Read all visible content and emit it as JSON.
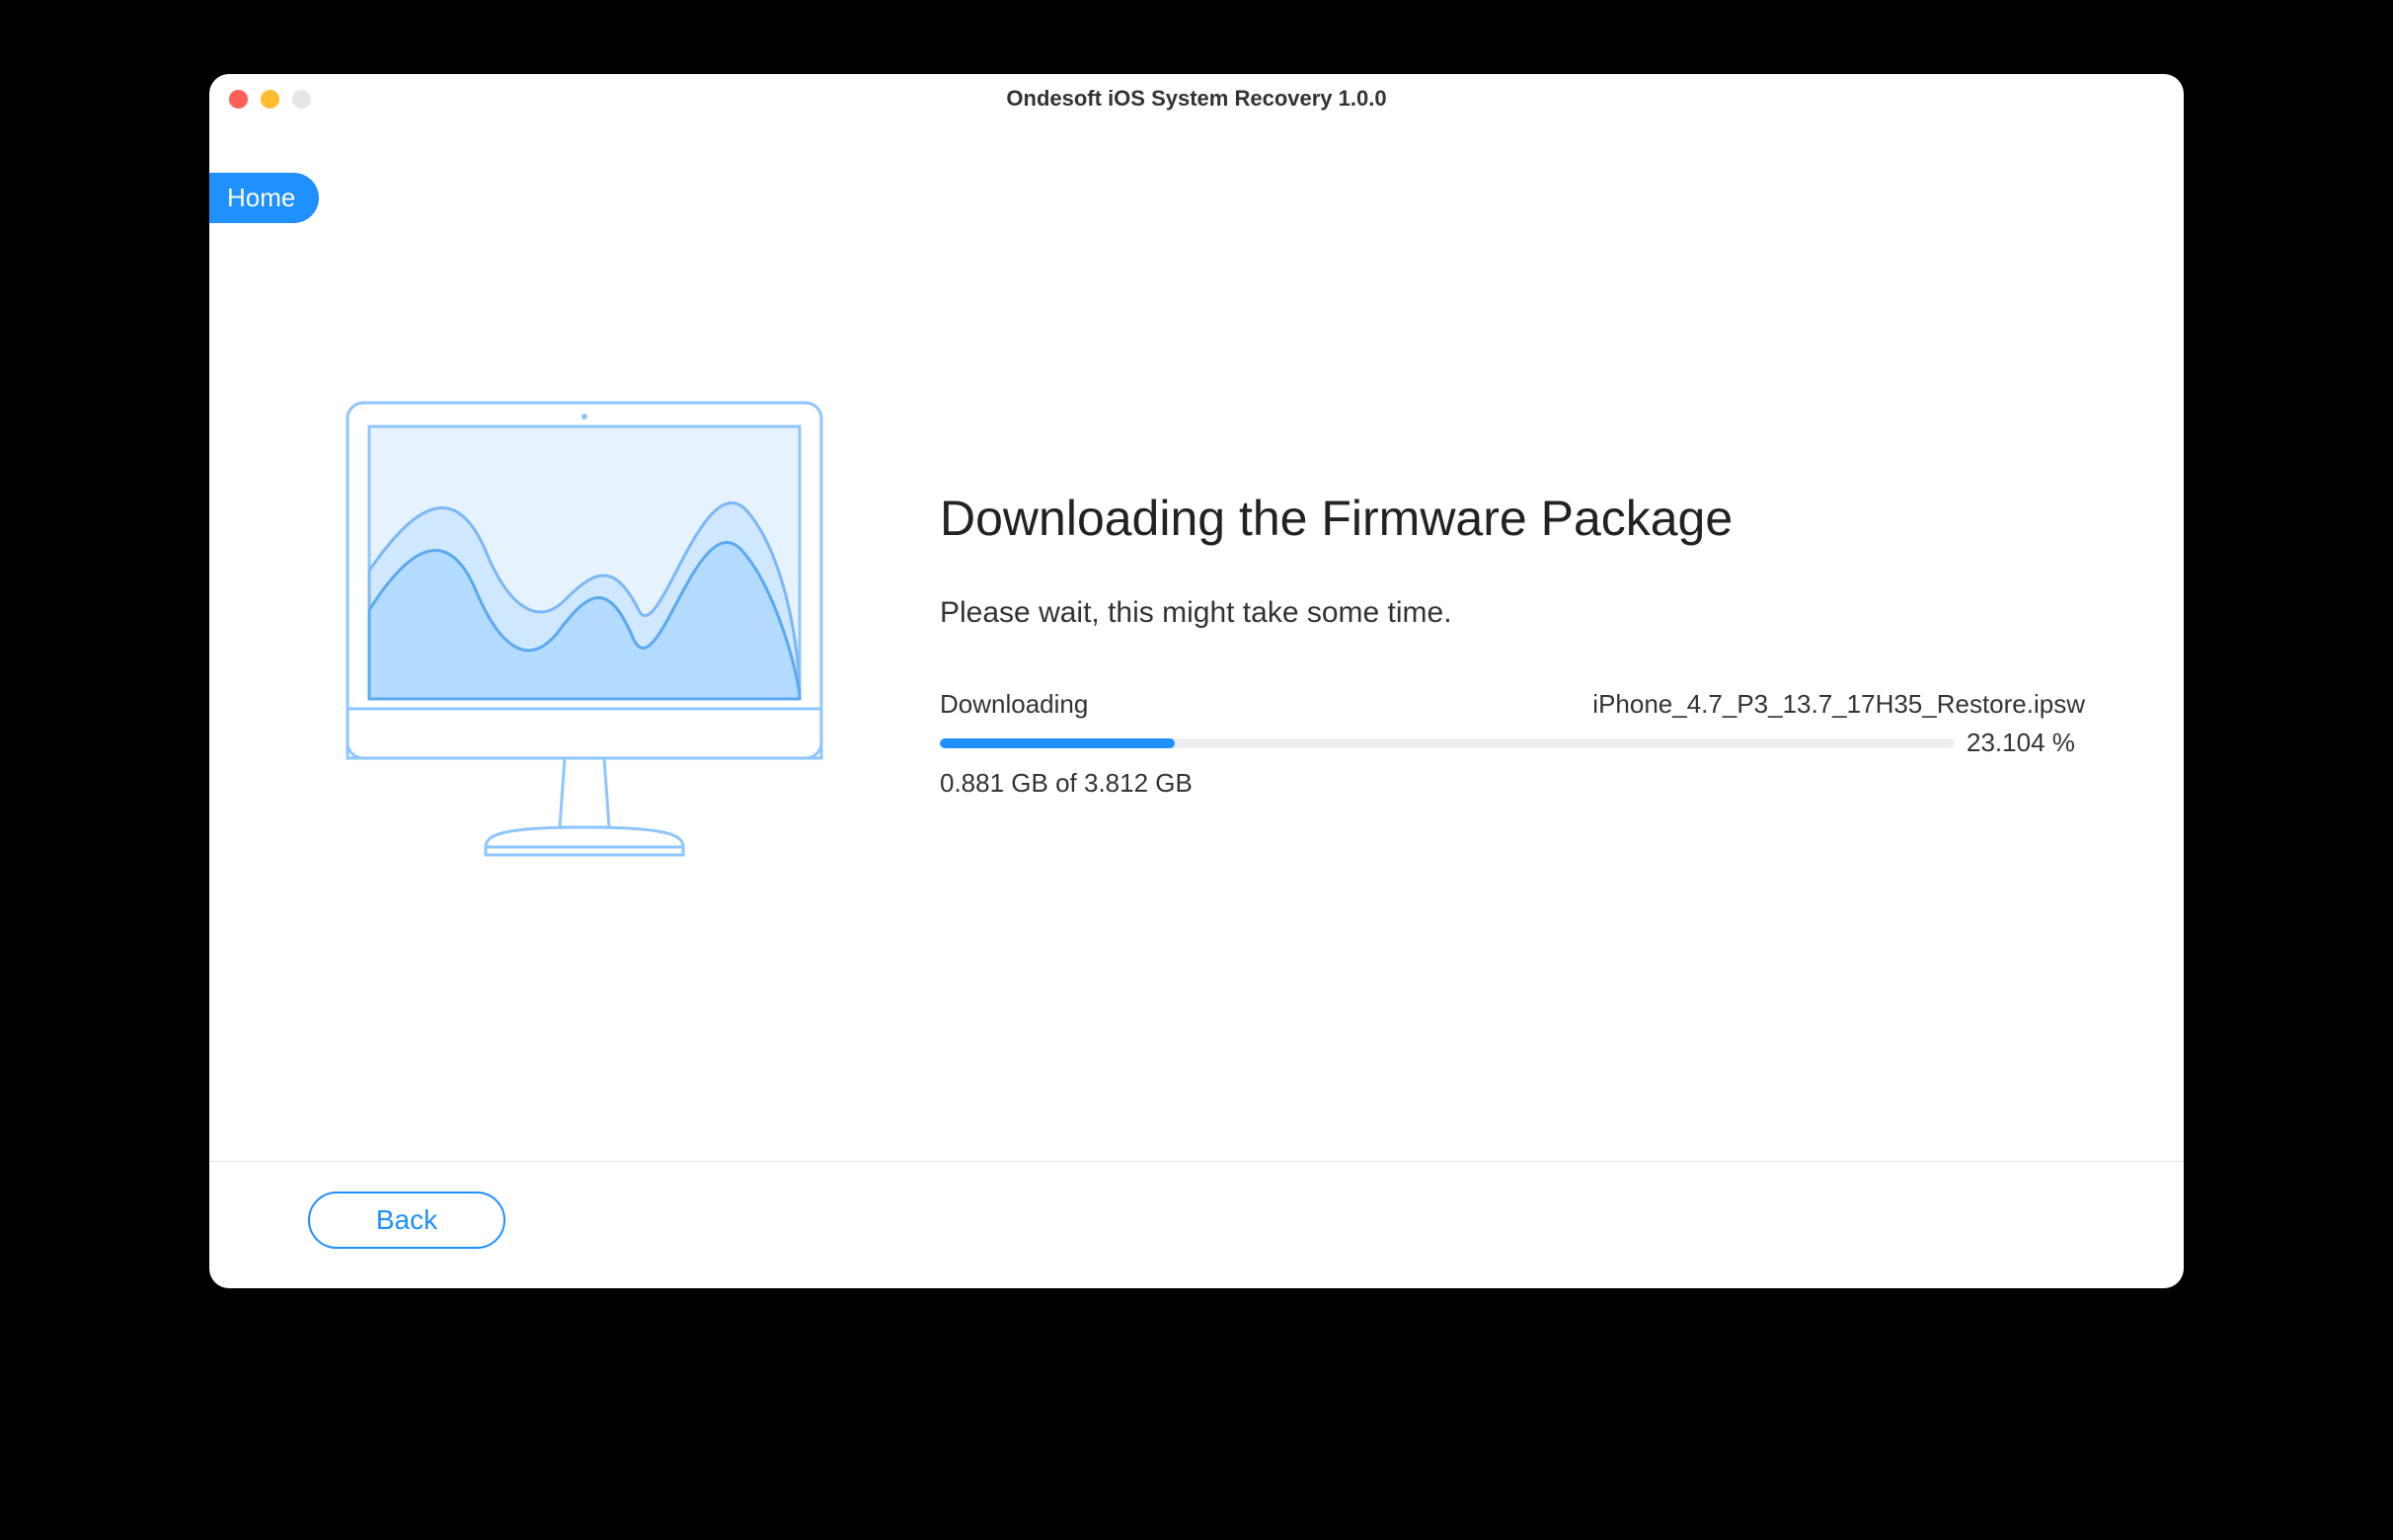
{
  "window": {
    "title": "Ondesoft iOS System Recovery 1.0.0"
  },
  "nav": {
    "home_label": "Home"
  },
  "main": {
    "heading": "Downloading the Firmware Package",
    "subtitle": "Please wait, this might take some time.",
    "download": {
      "status_label": "Downloading",
      "filename": "iPhone_4.7_P3_13.7_17H35_Restore.ipsw",
      "percent_text": "23.104 %",
      "percent_value": 23.104,
      "size_text": "0.881 GB of 3.812 GB"
    }
  },
  "footer": {
    "back_label": "Back"
  }
}
